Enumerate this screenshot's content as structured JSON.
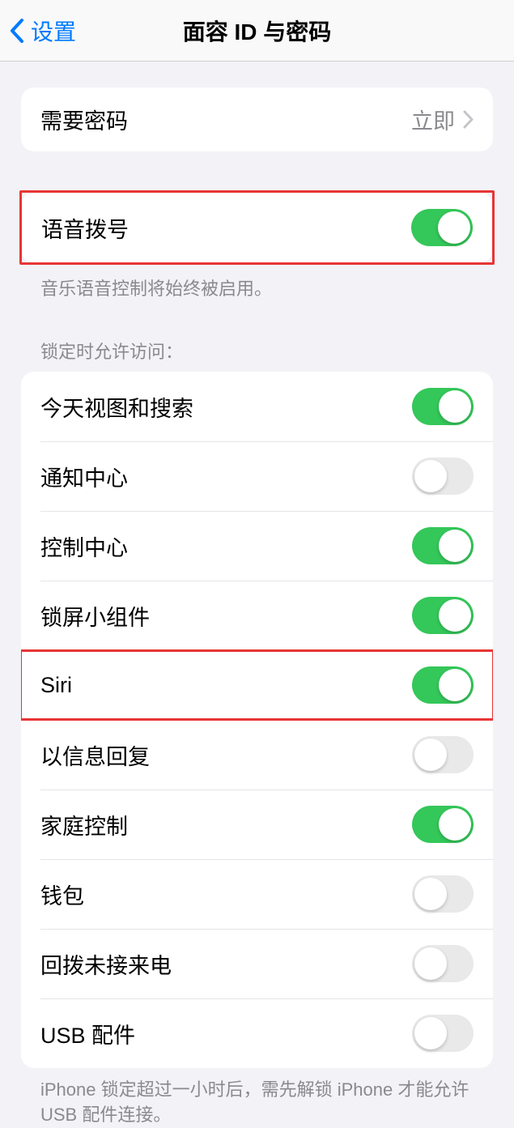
{
  "nav": {
    "back_label": "设置",
    "title": "面容 ID 与密码"
  },
  "section1": {
    "require_passcode_label": "需要密码",
    "require_passcode_value": "立即"
  },
  "section2": {
    "voice_dial_label": "语音拨号",
    "voice_dial_on": true,
    "footer": "音乐语音控制将始终被启用。"
  },
  "section3": {
    "header": "锁定时允许访问：",
    "items": [
      {
        "label": "今天视图和搜索",
        "on": true
      },
      {
        "label": "通知中心",
        "on": false
      },
      {
        "label": "控制中心",
        "on": true
      },
      {
        "label": "锁屏小组件",
        "on": true
      },
      {
        "label": "Siri",
        "on": true,
        "highlight": true
      },
      {
        "label": "以信息回复",
        "on": false
      },
      {
        "label": "家庭控制",
        "on": true
      },
      {
        "label": "钱包",
        "on": false
      },
      {
        "label": "回拨未接来电",
        "on": false
      },
      {
        "label": "USB 配件",
        "on": false
      }
    ],
    "footer": "iPhone 锁定超过一小时后，需先解锁 iPhone 才能允许 USB 配件连接。"
  }
}
